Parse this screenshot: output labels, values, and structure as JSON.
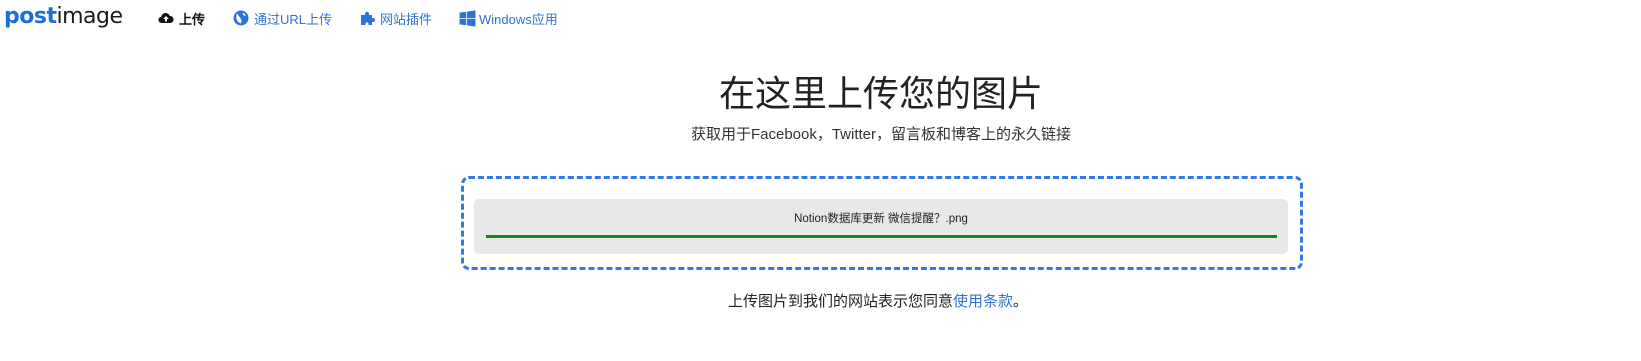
{
  "logo": {
    "part1": "post",
    "part2": "image"
  },
  "nav": {
    "upload": "上传",
    "url_upload": "通过URL上传",
    "plugins": "网站插件",
    "windows_app": "Windows应用"
  },
  "hero": {
    "title": "在这里上传您的图片",
    "subtitle": "获取用于Facebook，Twitter，留言板和博客上的永久链接"
  },
  "upload": {
    "file_name": "Notion数据库更新 微信提醒？.png",
    "progress": 1.0
  },
  "terms": {
    "prefix": "上传图片到我们的网站表示您同意",
    "link": "使用条款",
    "suffix": "。"
  },
  "colors": {
    "accent": "#2f73d2",
    "dropzone_border": "#2f7ae5",
    "progress": "#0f8a12"
  },
  "icons": {
    "upload": "cloud-upload-icon",
    "url": "globe-icon",
    "plugins": "puzzle-icon",
    "windows": "windows-icon"
  }
}
